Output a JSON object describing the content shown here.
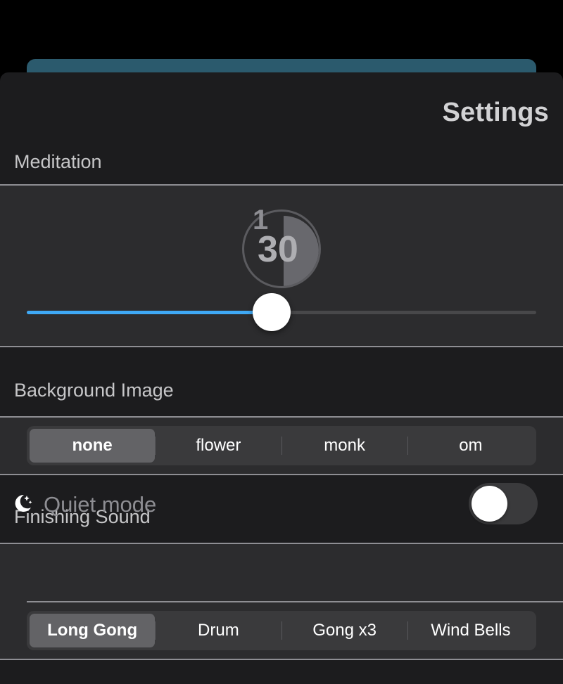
{
  "settings": {
    "title": "Settings",
    "meditation": {
      "header": "Meditation",
      "timer_minutes": "1",
      "timer_seconds": "30",
      "slider_fraction": 0.48
    },
    "background_image": {
      "header": "Background Image",
      "options": [
        "none",
        "flower",
        "monk",
        "om"
      ],
      "selected": "none"
    },
    "finishing_sound": {
      "header": "Finishing Sound",
      "quiet_mode_label": "Quiet mode",
      "quiet_mode_on": false,
      "options": [
        "Long Gong",
        "Drum",
        "Gong x3",
        "Wind Bells"
      ],
      "selected": "Long Gong"
    }
  },
  "colors": {
    "accent": "#3fa9f5",
    "sheet_bg": "#1c1c1e",
    "group_bg": "#2c2c2e",
    "selected_segment": "#636366"
  },
  "icons": {
    "quiet_mode": "moon-stars-icon"
  }
}
